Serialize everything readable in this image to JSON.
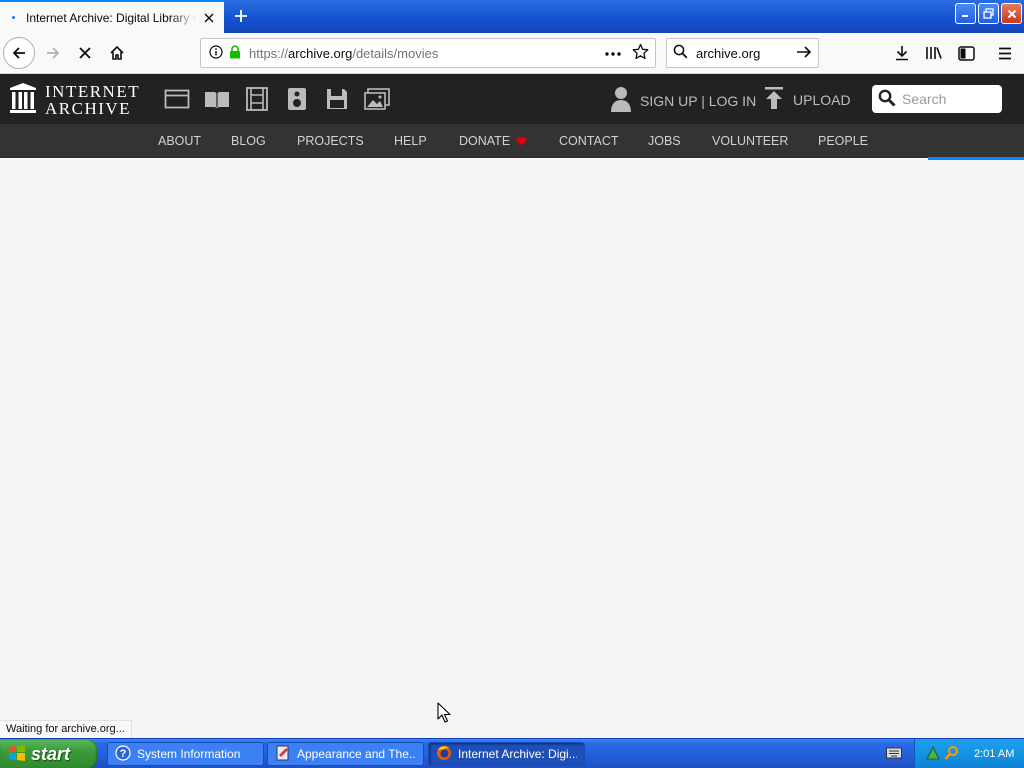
{
  "browser": {
    "tab": {
      "title": "Internet Archive: Digital Library of Free & Borrowable Books, Movies, Music & Wayback Machine"
    },
    "url": {
      "prefix": "https://",
      "domain": "archive.org",
      "path": "/details/movies"
    },
    "search": {
      "value": "archive.org"
    },
    "status": "Waiting for archive.org...",
    "icons": [
      "back-icon",
      "forward-icon",
      "stop-icon",
      "home-icon",
      "info-icon",
      "lock-icon",
      "more-icon",
      "star-icon",
      "search-icon",
      "go-arrow-icon",
      "download-icon",
      "library-icon",
      "sidebar-icon",
      "menu-icon"
    ],
    "accent": "#0a84ff"
  },
  "ia": {
    "logo": {
      "line1": "INTERNET",
      "line2": "ARCHIVE"
    },
    "media_icons": [
      "web-icon",
      "texts-icon",
      "video-icon",
      "audio-icon",
      "software-icon",
      "images-icon"
    ],
    "user_label": "SIGN UP | LOG IN",
    "upload_label": "UPLOAD",
    "search_placeholder": "Search",
    "nav": [
      {
        "label": "ABOUT"
      },
      {
        "label": "BLOG"
      },
      {
        "label": "PROJECTS"
      },
      {
        "label": "HELP"
      },
      {
        "label": "DONATE"
      },
      {
        "label": "CONTACT"
      },
      {
        "label": "JOBS"
      },
      {
        "label": "VOLUNTEER"
      },
      {
        "label": "PEOPLE"
      }
    ],
    "header_bg": "#222222",
    "nav_bg": "#333333",
    "donate_heart_color": "#e00000"
  },
  "taskbar": {
    "start_label": "start",
    "tasks": [
      {
        "label": "System Information",
        "icon": "help-icon"
      },
      {
        "label": "Appearance and The...",
        "icon": "appearance-icon"
      },
      {
        "label": "Internet Archive: Digi...",
        "icon": "firefox-icon",
        "active": true
      }
    ],
    "clock": "2:01 AM"
  }
}
